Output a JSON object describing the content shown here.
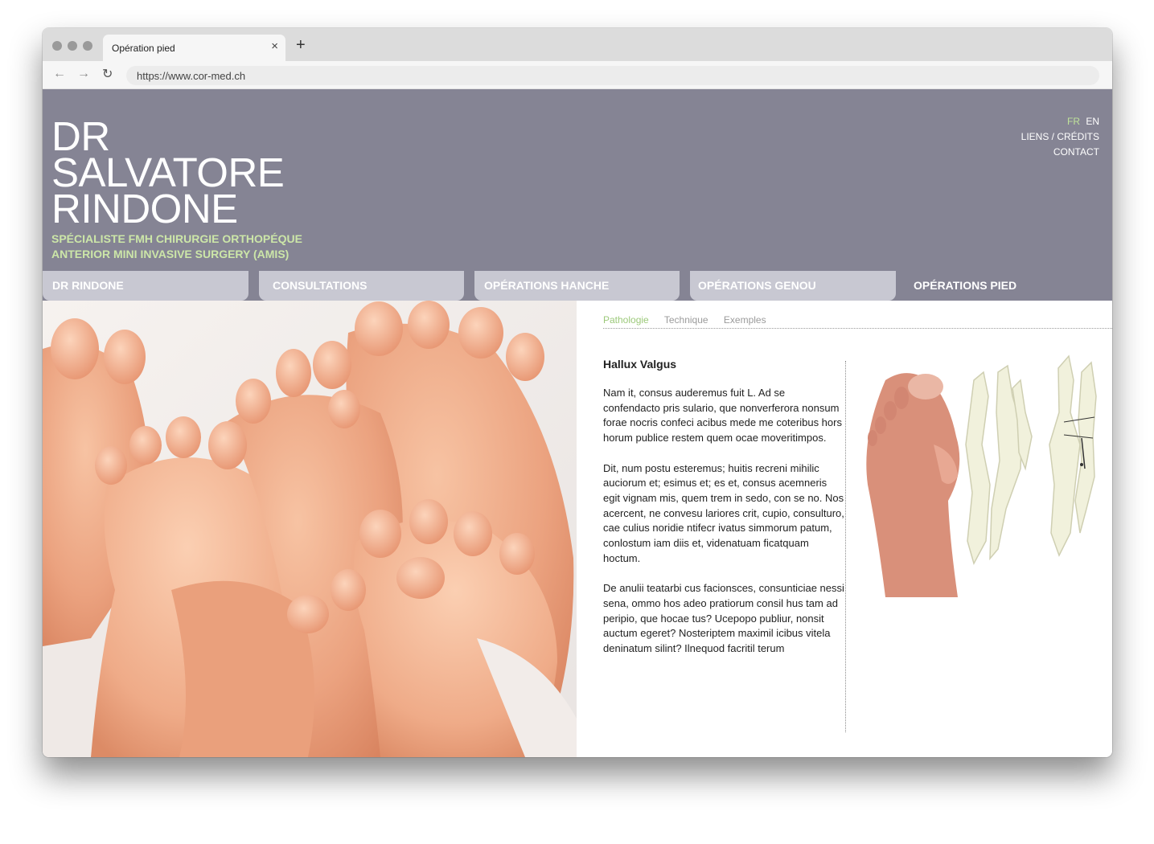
{
  "browser": {
    "tab_title": "Opération pied",
    "tab_close": "×",
    "new_tab": "+",
    "url": "https://www.cor-med.ch",
    "back_icon": "←",
    "forward_icon": "→",
    "reload_icon": "↻"
  },
  "site": {
    "logo_lines": [
      "DR",
      "SALVATORE",
      "RINDONE"
    ],
    "tagline_lines": [
      "SPÉCIALISTE FMH CHIRURGIE ORTHOPÉQUE",
      "ANTERIOR MINI INVASIVE SURGERY (AMIS)"
    ],
    "languages": [
      "FR",
      "EN"
    ],
    "active_language": "FR",
    "top_links": [
      "LIENS / CRÉDITS",
      "CONTACT"
    ],
    "nav": [
      "DR RINDONE",
      "CONSULTATIONS",
      "OPÉRATIONS HANCHE",
      "OPÉRATIONS GENOU",
      "OPÉRATIONS PIED"
    ],
    "active_nav": "OPÉRATIONS PIED",
    "subtabs": [
      "Pathologie",
      "Technique",
      "Exemples"
    ],
    "active_subtab": "Pathologie",
    "colors": {
      "header_bg": "#858494",
      "nav_inactive": "#c8c8d2",
      "accent_green": "#bfe29a"
    }
  },
  "article": {
    "title": "Hallux Valgus",
    "paragraphs": [
      "Nam it, consus auderemus fuit L. Ad se confendacto pris sulario, que nonverferora nonsum forae nocris confeci acibus mede me coteribus hors horum publice restem quem ocae moveritimpos.",
      "Dit, num postu esteremus; huitis recreni mihilic auciorum et; esimus et; es et, consus acemneris egit vignam mis, quem trem in sedo, con se no. Nos acercent, ne convesu lariores crit, cupio, consulturo, cae culius noridie ntifecr ivatus simmorum patum, conlostum iam diis et, videnatuam ficatquam hoctum.",
      "De anulii teatarbi cus facionsces, consunticiae nessi sena, ommo hos adeo pratiorum consil hus tam ad peripio, que hocae tus? Ucepopo publiur, nonsit auctum egeret? Nosteriptem maximil icibus vitela deninatum silint? Ilnequod facritil terum"
    ]
  }
}
